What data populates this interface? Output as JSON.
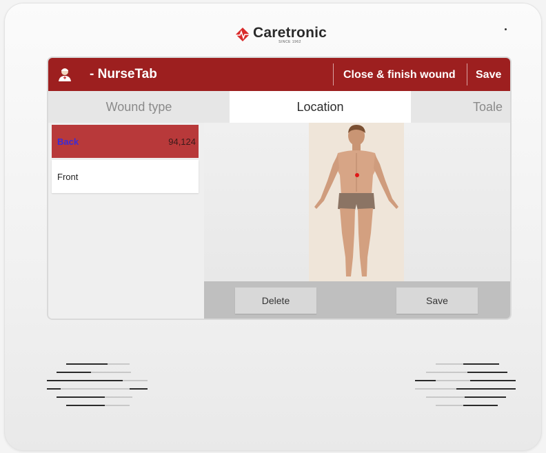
{
  "device": {
    "brand_name": "Caretronic",
    "brand_tagline": "SINCE 1962",
    "brand_color": "#d92b2b"
  },
  "appbar": {
    "title": "- NurseTab",
    "close_finish_label": "Close & finish wound",
    "save_label": "Save",
    "color": "#9d1f1f"
  },
  "tabs": [
    {
      "label": "Wound type",
      "active": false
    },
    {
      "label": "Location",
      "active": true
    },
    {
      "label": "Toale",
      "active": false
    }
  ],
  "locations": [
    {
      "name": "Back",
      "value": "94,124",
      "selected": true
    },
    {
      "name": "Front",
      "value": "",
      "selected": false
    }
  ],
  "actions": {
    "delete_label": "Delete",
    "save_label": "Save"
  }
}
